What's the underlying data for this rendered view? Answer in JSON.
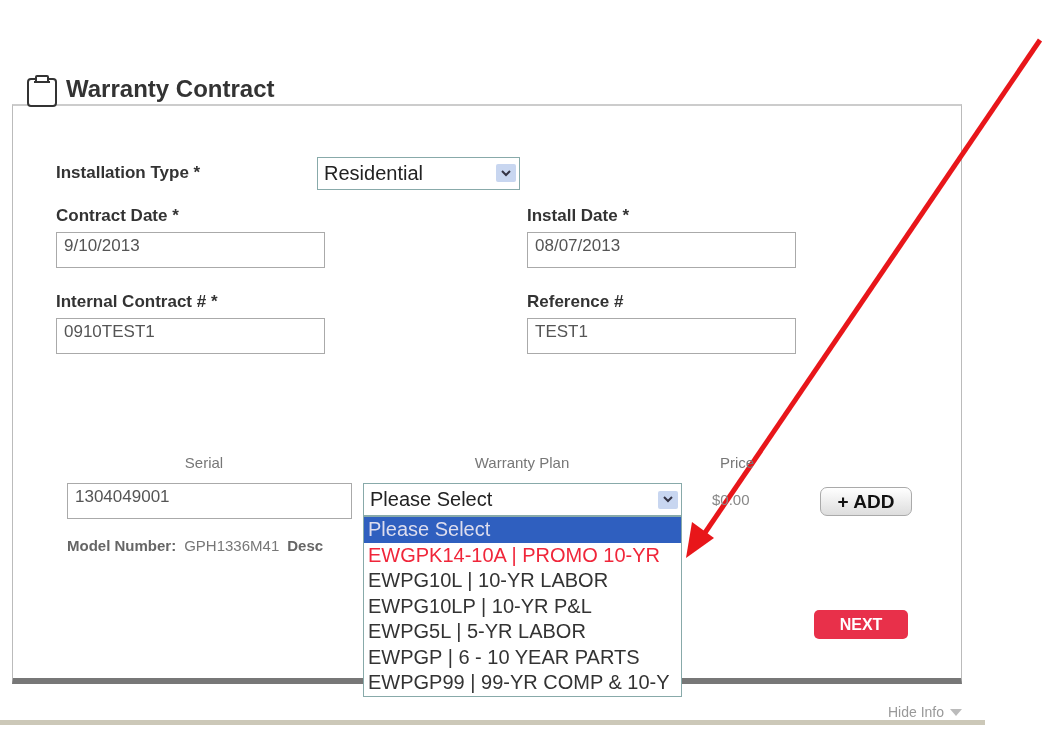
{
  "section": {
    "title": "Warranty Contract"
  },
  "installation_type": {
    "label": "Installation Type *",
    "value": "Residential"
  },
  "fields": [
    {
      "label": "Contract Date *",
      "value": "9/10/2013"
    },
    {
      "label": "Install Date *",
      "value": "08/07/2013"
    },
    {
      "label": "Internal Contract # *",
      "value": "0910TEST1"
    },
    {
      "label": "Reference #",
      "value": "TEST1"
    }
  ],
  "equipment": {
    "columns": [
      "Serial",
      "Warranty Plan",
      "Price"
    ],
    "serial": "1304049001",
    "plan": "Please Select",
    "price": "$0.00",
    "add_button": "+ ADD",
    "model_label": "Model Number:",
    "model_value": "GPH1336M41",
    "description_label": "Desc",
    "plan_options": [
      {
        "label": "Please Select",
        "selected": true,
        "highlighted": false
      },
      {
        "label": "EWGPK14-10A | PROMO 10-YR",
        "selected": false,
        "highlighted": true
      },
      {
        "label": "EWPG10L | 10-YR LABOR",
        "selected": false,
        "highlighted": false
      },
      {
        "label": "EWPG10LP | 10-YR P&L",
        "selected": false,
        "highlighted": false
      },
      {
        "label": "EWPG5L | 5-YR LABOR",
        "selected": false,
        "highlighted": false
      },
      {
        "label": "EWPGP | 6 - 10 YEAR PARTS",
        "selected": false,
        "highlighted": false
      },
      {
        "label": "EWPGP99 | 99-YR COMP & 10-Y",
        "selected": false,
        "highlighted": false
      }
    ]
  },
  "next_button": "NEXT",
  "hide_info": "Hide Info"
}
